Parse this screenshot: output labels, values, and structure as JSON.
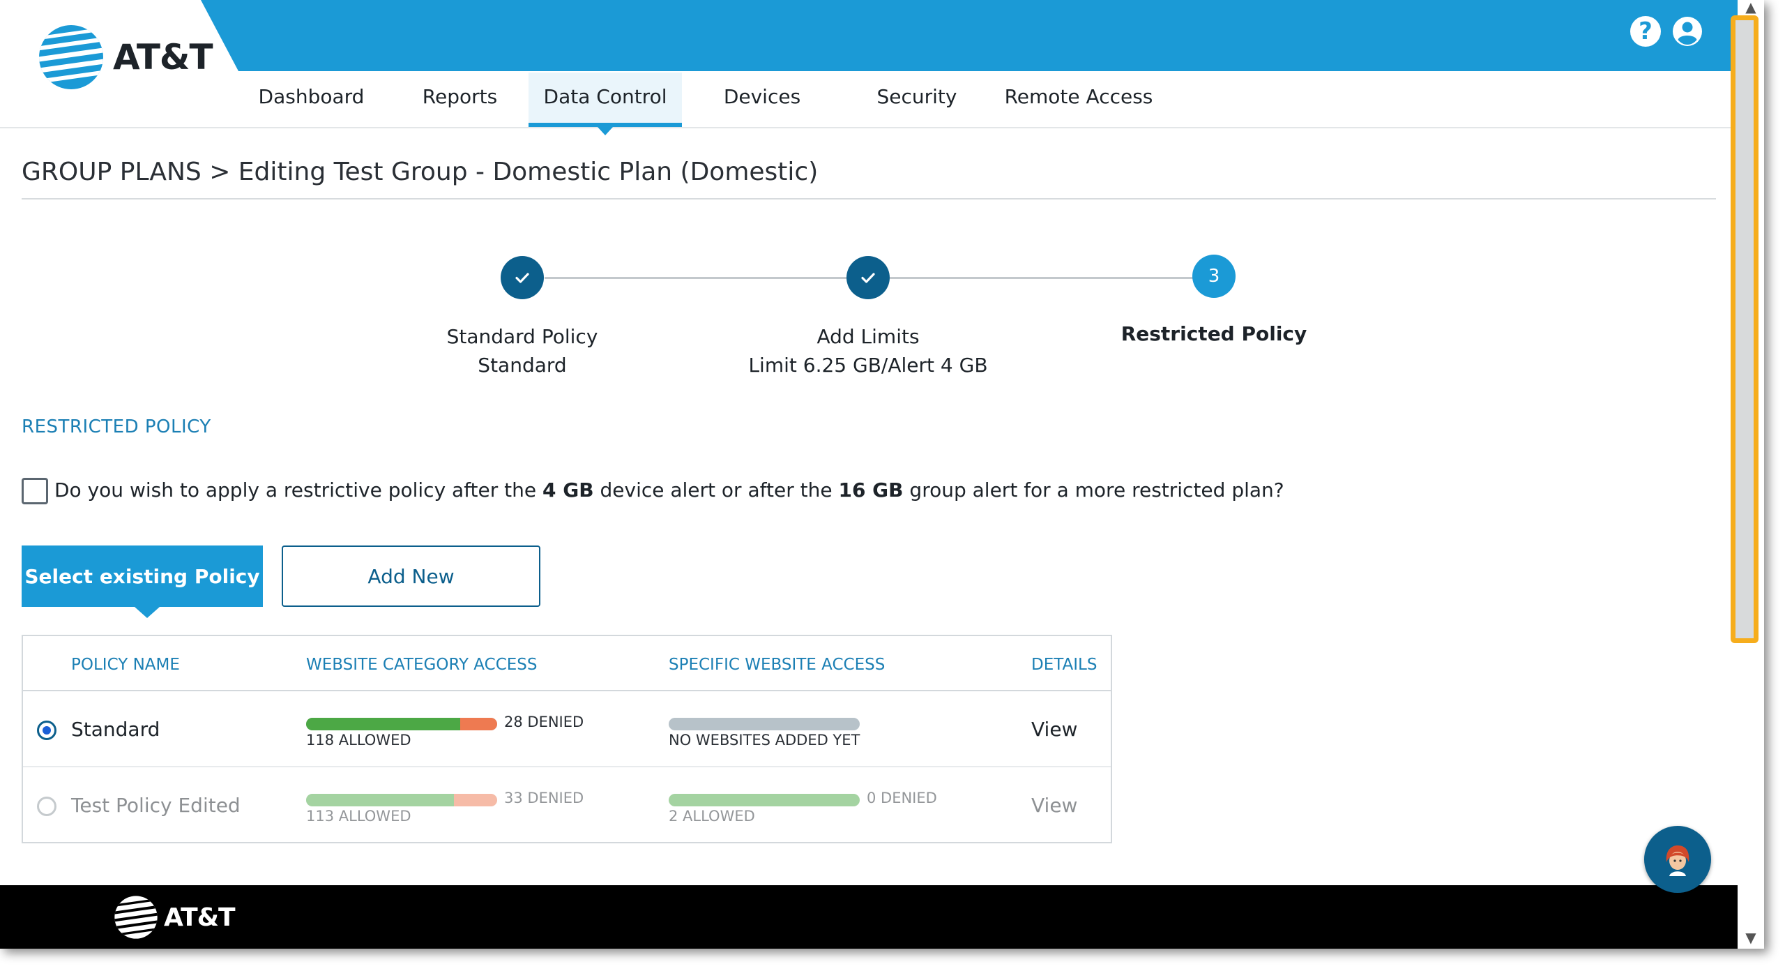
{
  "header": {
    "brand": "AT&T",
    "colors": {
      "primary": "#1b9ad6",
      "dark": "#0c5f8c",
      "text": "#1d2329",
      "scroll_highlight": "#f6ad1c"
    },
    "icons": {
      "help": "question-circle-icon",
      "account": "user-circle-icon"
    },
    "help_glyph": "?",
    "nav": [
      {
        "label": "Dashboard",
        "active": false
      },
      {
        "label": "Reports",
        "active": false
      },
      {
        "label": "Data Control",
        "active": true
      },
      {
        "label": "Devices",
        "active": false
      },
      {
        "label": "Security",
        "active": false
      },
      {
        "label": "Remote Access",
        "active": false
      }
    ]
  },
  "page": {
    "breadcrumb": "GROUP PLANS > Editing Test Group - Domestic Plan (Domestic)"
  },
  "stepper": {
    "steps": [
      {
        "status": "done",
        "marker": "✓",
        "title": "Standard Policy",
        "subtitle": "Standard"
      },
      {
        "status": "done",
        "marker": "✓",
        "title": "Add Limits",
        "subtitle": "Limit 6.25 GB/Alert 4 GB"
      },
      {
        "status": "current",
        "marker": "3",
        "title": "Restricted Policy",
        "subtitle": ""
      }
    ]
  },
  "restricted": {
    "section_title": "RESTRICTED POLICY",
    "checkbox_checked": false,
    "question": {
      "part1": "Do you wish to apply a restrictive policy after the ",
      "device_alert": "4 GB",
      "part2": " device alert or after the ",
      "group_alert": "16 GB",
      "part3": " group alert for a more restricted plan?"
    },
    "select_button": "Select existing Policy",
    "add_button": "Add New"
  },
  "table": {
    "headers": {
      "policy_name": "POLICY NAME",
      "category_access": "WEBSITE CATEGORY ACCESS",
      "specific_access": "SPECIFIC WEBSITE ACCESS",
      "details": "DETAILS"
    },
    "rows": [
      {
        "selected": true,
        "name": "Standard",
        "category": {
          "allowed": 118,
          "denied": 28,
          "allowed_label": "118 ALLOWED",
          "denied_label": "28 DENIED"
        },
        "specific": {
          "allowed": 0,
          "denied": 0,
          "empty_label": "NO WEBSITES ADDED YET",
          "allowed_label": "",
          "denied_label": ""
        },
        "details": "View"
      },
      {
        "selected": false,
        "name": "Test Policy Edited",
        "category": {
          "allowed": 113,
          "denied": 33,
          "allowed_label": "113 ALLOWED",
          "denied_label": "33 DENIED"
        },
        "specific": {
          "allowed": 2,
          "denied": 0,
          "empty_label": "",
          "allowed_label": "2 ALLOWED",
          "denied_label": "0 DENIED"
        },
        "details": "View"
      }
    ]
  },
  "footer": {
    "brand": "AT&T"
  },
  "chat": {
    "icon": "chat-assistant-avatar-icon"
  }
}
